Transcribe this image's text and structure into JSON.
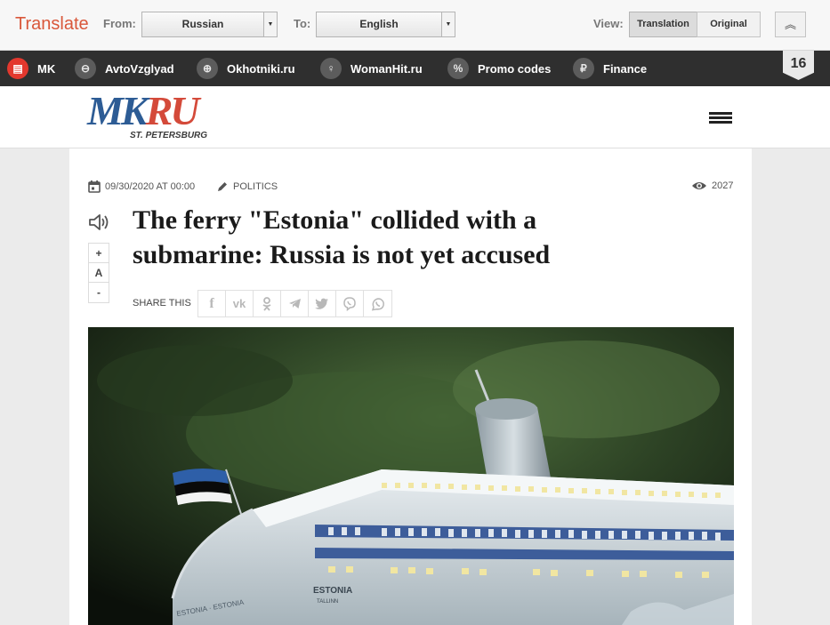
{
  "translate_bar": {
    "brand": "Translate",
    "from_label": "From:",
    "from_value": "Russian",
    "to_label": "To:",
    "to_value": "English",
    "view_label": "View:",
    "view_options": [
      "Translation",
      "Original"
    ],
    "view_selected": "Translation"
  },
  "nav": {
    "items": [
      {
        "label": "MK",
        "icon": "document-icon"
      },
      {
        "label": "AvtoVzglyad",
        "icon": "steering-wheel-icon"
      },
      {
        "label": "Okhotniki.ru",
        "icon": "target-icon"
      },
      {
        "label": "WomanHit.ru",
        "icon": "female-icon"
      },
      {
        "label": "Promo codes",
        "icon": "percent-icon"
      },
      {
        "label": "Finance",
        "icon": "ruble-icon"
      }
    ],
    "age_rating": "16"
  },
  "site": {
    "logo_main": "MK",
    "logo_accent": "RU",
    "logo_city": "ST. PETERSBURG"
  },
  "article": {
    "date": "09/30/2020 AT 00:00",
    "category": "POLITICS",
    "views": "2027",
    "title": "The ferry \"Estonia\" collided with a submarine: Russia is not yet accused",
    "font_controls": [
      "+",
      "A",
      "-"
    ],
    "share_label": "SHARE THIS",
    "share_buttons": [
      "facebook-icon",
      "vk-icon",
      "odnoklassniki-icon",
      "telegram-icon",
      "twitter-icon",
      "viber-icon",
      "whatsapp-icon"
    ],
    "image_ship_text": [
      "ESTONIA",
      "TALLINN",
      "ESTONIA · ESTONIA"
    ]
  },
  "colors": {
    "translate_brand": "#d9573a",
    "nav_bg": "#2f2f2f",
    "logo_blue": "#2d5c95",
    "logo_red": "#d44a3a"
  }
}
